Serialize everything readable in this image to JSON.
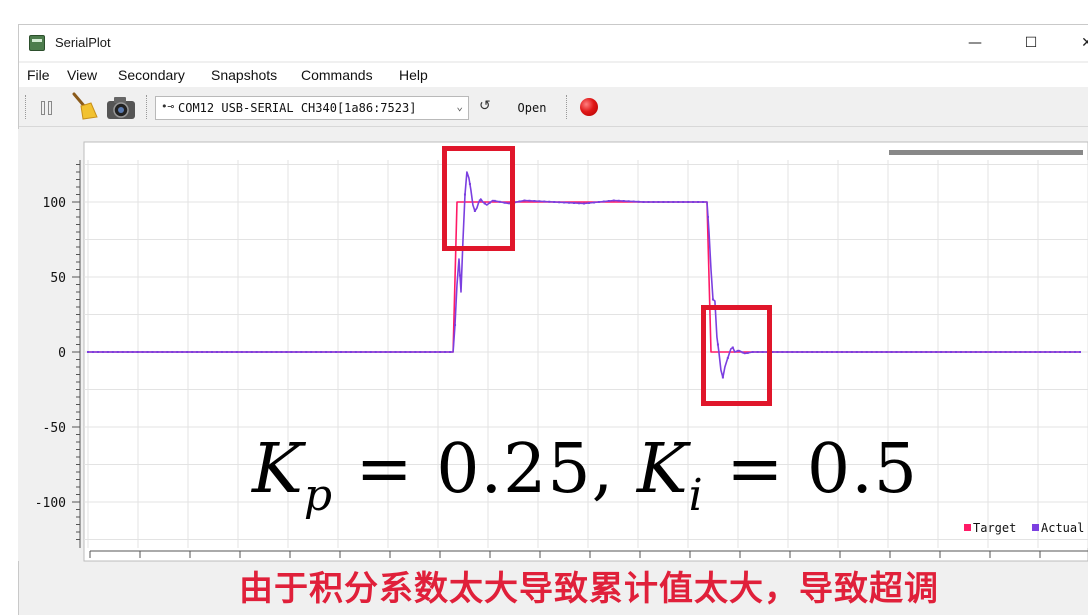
{
  "window": {
    "title": "SerialPlot",
    "controls": {
      "minimize": "—",
      "maximize": "☐",
      "close": "✕"
    }
  },
  "menu": [
    "File",
    "View",
    "Secondary",
    "Snapshots",
    "Commands",
    "Help"
  ],
  "toolbar": {
    "port_label": "COM12 USB-SERIAL CH340[1a86:7523]",
    "open_label": "Open",
    "icons": [
      "pause-icon",
      "broom-icon",
      "camera-icon",
      "usb-icon",
      "refresh-icon",
      "record-icon"
    ]
  },
  "chart_data": {
    "type": "line",
    "ylim": [
      -130,
      128
    ],
    "y_ticks": [
      100,
      50,
      0,
      -50,
      -100
    ],
    "y_tick_labels": [
      "100",
      "50",
      "0",
      "-50",
      "-100"
    ],
    "grid": true,
    "legend": "bottom-right",
    "series": [
      {
        "name": "Target",
        "color": "#ff1a66",
        "x": [
          0,
          368,
          372,
          624,
          628,
          1000
        ],
        "values": [
          0,
          0,
          100,
          100,
          0,
          0
        ]
      },
      {
        "name": "Actual",
        "color": "#7b3fe0",
        "x": [
          0,
          368,
          370,
          372,
          374,
          376,
          378,
          380,
          382,
          384,
          386,
          388,
          390,
          392,
          394,
          396,
          398,
          402,
          408,
          416,
          424,
          440,
          470,
          500,
          530,
          560,
          590,
          620,
          624,
          626,
          628,
          630,
          632,
          634,
          636,
          638,
          640,
          642,
          644,
          646,
          648,
          650,
          652,
          656,
          662,
          670,
          700,
          1000
        ],
        "values": [
          0,
          0,
          18,
          45,
          62,
          40,
          75,
          105,
          120,
          116,
          108,
          98,
          94,
          96,
          100,
          102,
          100,
          98,
          101,
          100,
          99,
          101,
          100,
          99,
          101,
          100,
          100,
          100,
          100,
          80,
          55,
          35,
          34,
          10,
          0,
          -12,
          -17,
          -10,
          -6,
          -2,
          2,
          3,
          0,
          1,
          -1,
          0,
          0,
          0
        ]
      }
    ]
  },
  "annotation": {
    "formula": {
      "k": "K",
      "sub_p": "p",
      "eq1": " = 0.25, ",
      "sub_i": "i",
      "eq2": " = 0.5"
    },
    "caption": "由于积分系数太大导致累计值太大，导致超调",
    "box_color": "#e0162b"
  }
}
